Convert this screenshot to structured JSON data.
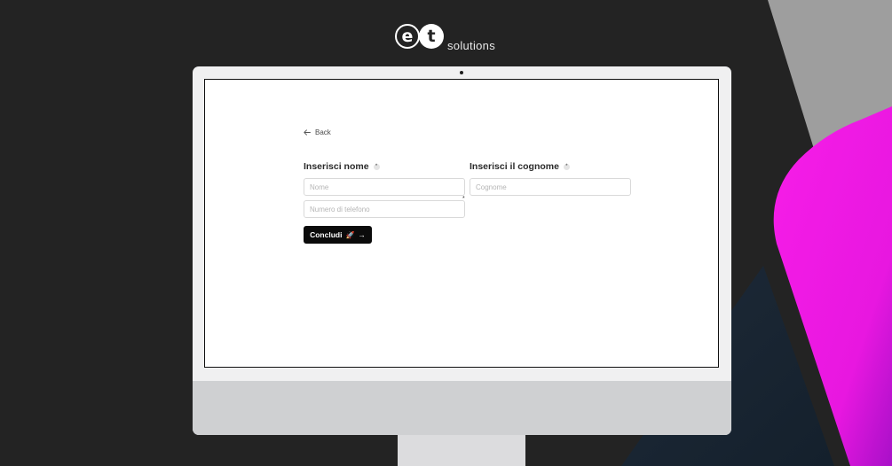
{
  "brand": {
    "logo_e": "e",
    "logo_t": "t",
    "logo_text": "solutions"
  },
  "form": {
    "back_label": "Back",
    "back_icon": "arrow-left-icon",
    "first_name": {
      "label": "Inserisci nome",
      "placeholder": "Nome",
      "value": ""
    },
    "last_name": {
      "label": "Inserisci il cognome",
      "placeholder": "Cognome",
      "value": ""
    },
    "phone": {
      "placeholder": "Numero di telefono",
      "value": "",
      "required_mark": "*"
    },
    "required_mark": "*",
    "submit": {
      "label": "Concludi",
      "emoji": "🚀",
      "arrow": "→"
    }
  },
  "colors": {
    "background": "#232323",
    "accent_magenta": "#f51ae6",
    "accent_gray": "#9e9e9e",
    "button": "#0b0b0b"
  }
}
